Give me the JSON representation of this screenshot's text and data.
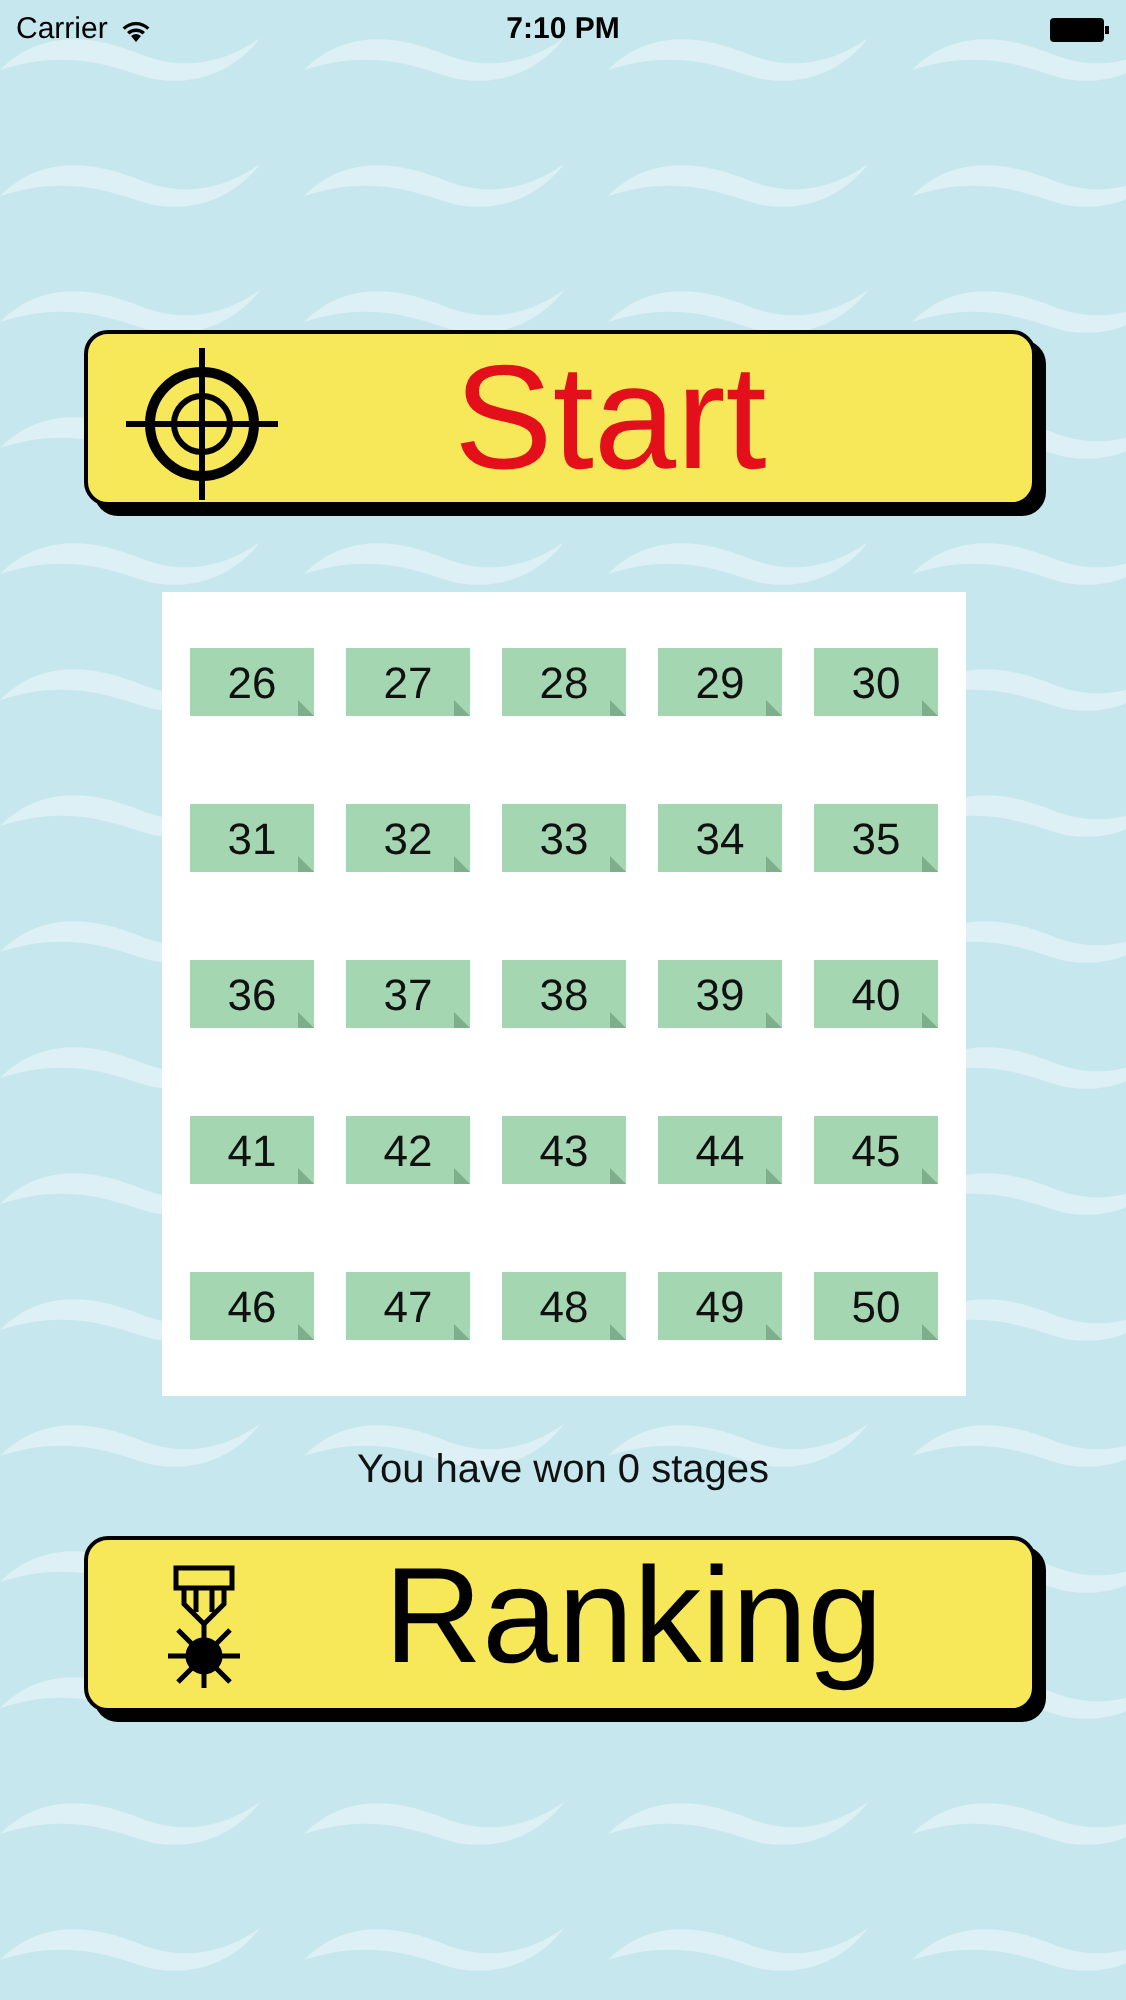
{
  "status_bar": {
    "carrier": "Carrier",
    "time": "7:10 PM"
  },
  "start_button": {
    "label": "Start"
  },
  "stages": [
    {
      "label": "26"
    },
    {
      "label": "27"
    },
    {
      "label": "28"
    },
    {
      "label": "29"
    },
    {
      "label": "30"
    },
    {
      "label": "31"
    },
    {
      "label": "32"
    },
    {
      "label": "33"
    },
    {
      "label": "34"
    },
    {
      "label": "35"
    },
    {
      "label": "36"
    },
    {
      "label": "37"
    },
    {
      "label": "38"
    },
    {
      "label": "39"
    },
    {
      "label": "40"
    },
    {
      "label": "41"
    },
    {
      "label": "42"
    },
    {
      "label": "43"
    },
    {
      "label": "44"
    },
    {
      "label": "45"
    },
    {
      "label": "46"
    },
    {
      "label": "47"
    },
    {
      "label": "48"
    },
    {
      "label": "49"
    },
    {
      "label": "50"
    }
  ],
  "summary": "You have won 0 stages",
  "ranking_button": {
    "label": "Ranking"
  }
}
